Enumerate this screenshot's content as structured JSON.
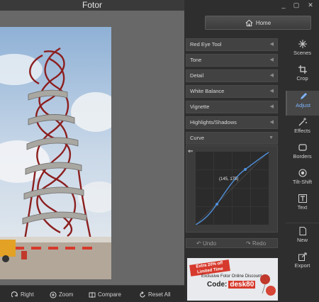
{
  "app": {
    "title": "Fotor"
  },
  "header": {
    "home_label": "Home"
  },
  "window_controls": [
    "_",
    "▢",
    "✕"
  ],
  "adjust_panel": {
    "sections": [
      {
        "label": "Red Eye Tool"
      },
      {
        "label": "Tone"
      },
      {
        "label": "Detail"
      },
      {
        "label": "White Balance"
      },
      {
        "label": "Vignette"
      },
      {
        "label": "Highlights/Shadows"
      },
      {
        "label": "Curve"
      }
    ],
    "curve_readout": "(145, 175)"
  },
  "history": {
    "undo_label": "Undo",
    "redo_label": "Redo"
  },
  "ad": {
    "ribbon": "Extra 20% off\nLimited Time",
    "headline": "Exclusive Fotor Online Discount",
    "code_label": "Code:",
    "code_value": "desk80"
  },
  "tools": [
    {
      "label": "Scenes",
      "icon": "sparkle-icon"
    },
    {
      "label": "Crop",
      "icon": "crop-icon"
    },
    {
      "label": "Adjust",
      "icon": "pencil-icon",
      "active": true
    },
    {
      "label": "Effects",
      "icon": "magic-wand-icon"
    },
    {
      "label": "Borders",
      "icon": "border-frame-icon"
    },
    {
      "label": "Tilt-Shift",
      "icon": "tilt-shift-icon"
    },
    {
      "label": "Text",
      "icon": "text-icon"
    },
    {
      "label": "New",
      "icon": "new-file-icon"
    },
    {
      "label": "Export",
      "icon": "export-icon"
    }
  ],
  "bottom_bar": {
    "rotate_right": "Right",
    "zoom": "Zoom",
    "compare": "Compare",
    "reset_all": "Reset All"
  },
  "colors": {
    "accent": "#7fb4ff",
    "curve": "#4f8fd9",
    "ad_red": "#d63a2c"
  }
}
